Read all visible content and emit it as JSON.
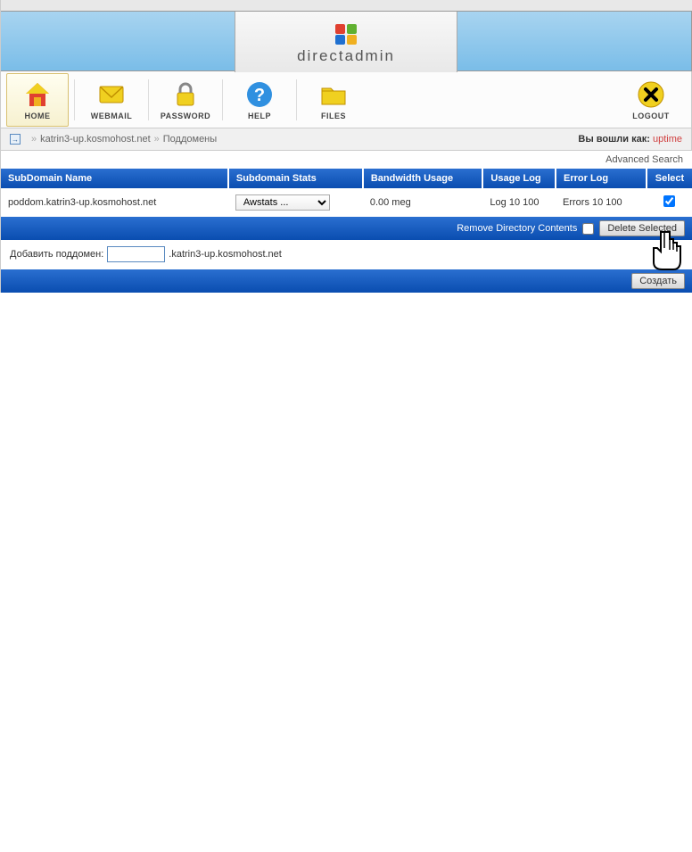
{
  "brand": "directadmin",
  "toolbar": {
    "home": "HOME",
    "webmail": "WEBMAIL",
    "password": "PASSWORD",
    "help": "HELP",
    "files": "FILES",
    "logout": "LOGOUT"
  },
  "breadcrumb": {
    "sep": "»",
    "domain": "katrin3-up.kosmohost.net",
    "page": "Поддомены",
    "logged_in_as": "Вы вошли как:",
    "user": "uptime"
  },
  "adv_search": "Advanced Search",
  "table": {
    "headers": {
      "name": "SubDomain Name",
      "stats": "Subdomain Stats",
      "bandwidth": "Bandwidth Usage",
      "usage": "Usage Log",
      "error": "Error Log",
      "select": "Select"
    },
    "rows": [
      {
        "name": "poddom.katrin3-up.kosmohost.net",
        "stats_selected": "Awstats ...",
        "bandwidth": "0.00 meg",
        "usage": "Log 10 100",
        "error": "Errors 10 100",
        "selected": true
      }
    ]
  },
  "actions": {
    "remove_dir": "Remove Directory Contents",
    "delete": "Delete Selected"
  },
  "add": {
    "label": "Добавить поддомен:",
    "suffix": ".katrin3-up.kosmohost.net",
    "value": ""
  },
  "create_btn": "Создать"
}
